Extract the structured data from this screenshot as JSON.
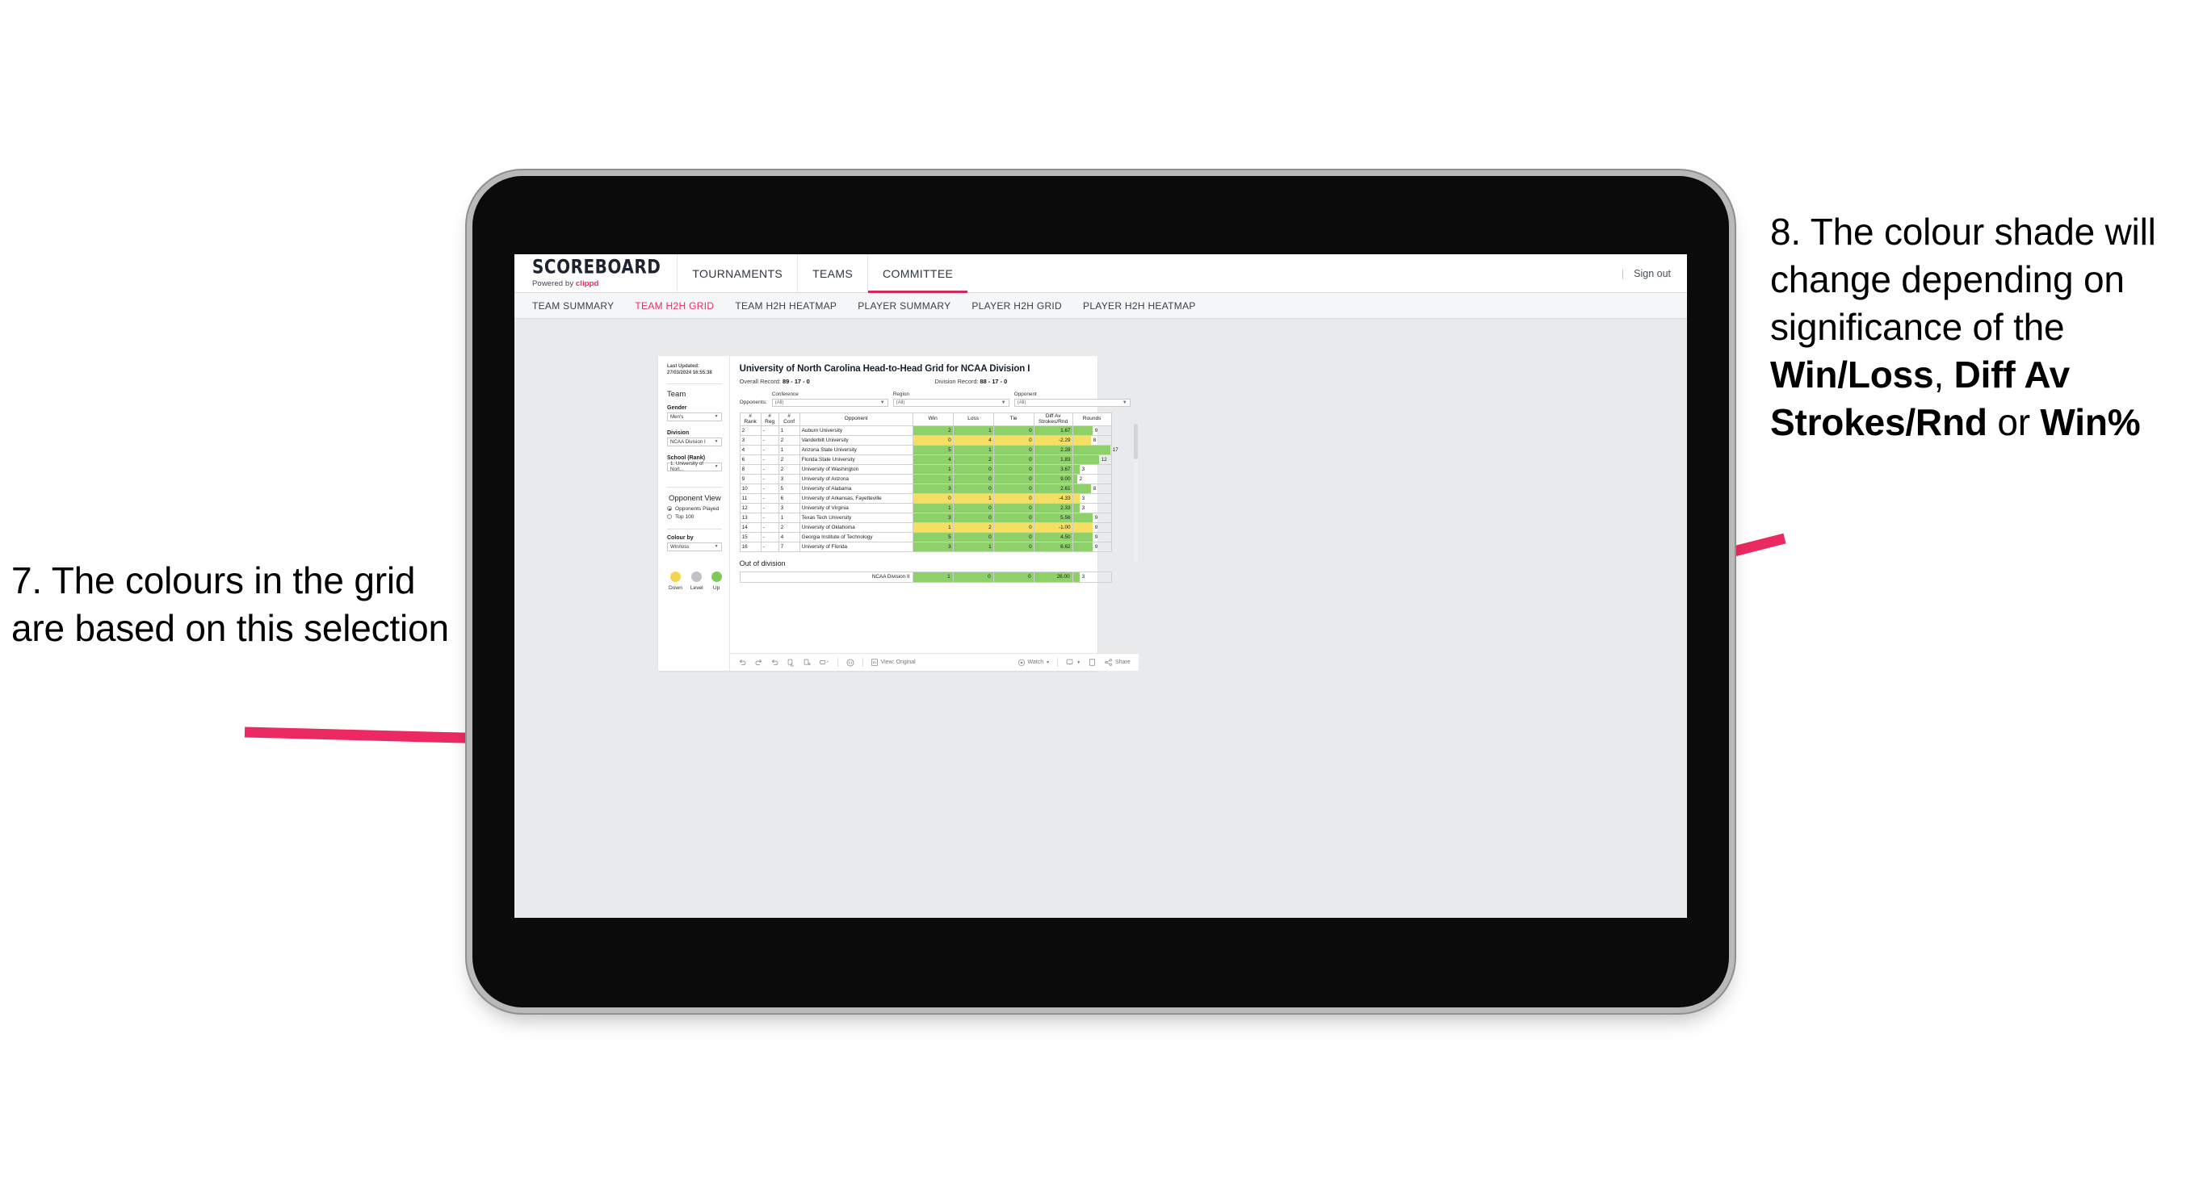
{
  "annotations": {
    "left": {
      "number": "7.",
      "text": "7. The colours in the grid are based on this selection"
    },
    "right": {
      "part1": "8. The colour shade will change depending on significance of the ",
      "bold1": "Win/Loss",
      "mid1": ", ",
      "bold2": "Diff Av Strokes/Rnd",
      "mid2": " or ",
      "bold3": "Win%"
    },
    "arrow_color": "#ec2a62"
  },
  "topnav": {
    "logo": "SCOREBOARD",
    "tagline_prefix": "Powered by ",
    "tagline_brand": "clippd",
    "items": [
      {
        "label": "TOURNAMENTS",
        "active": false
      },
      {
        "label": "TEAMS",
        "active": false
      },
      {
        "label": "COMMITTEE",
        "active": true
      }
    ],
    "signout": "Sign out",
    "separator": "|",
    "accent": "#d0295a"
  },
  "subnav": {
    "items": [
      {
        "label": "TEAM SUMMARY",
        "active": false
      },
      {
        "label": "TEAM H2H GRID",
        "active": true
      },
      {
        "label": "TEAM H2H HEATMAP",
        "active": false
      },
      {
        "label": "PLAYER SUMMARY",
        "active": false
      },
      {
        "label": "PLAYER H2H GRID",
        "active": false
      },
      {
        "label": "PLAYER H2H HEATMAP",
        "active": false
      }
    ]
  },
  "filters": {
    "last_updated": "Last Updated: 27/03/2024 16:55:38",
    "team_heading": "Team",
    "gender_label": "Gender",
    "gender_value": "Men's",
    "division_label": "Division",
    "division_value": "NCAA Division I",
    "school_label": "School (Rank)",
    "school_value": "1. University of Nort...",
    "opponent_view_heading": "Opponent View",
    "opponent_view_options": [
      {
        "label": "Opponents Played",
        "selected": true
      },
      {
        "label": "Top 100",
        "selected": false
      }
    ],
    "colour_by_label": "Colour by",
    "colour_by_value": "Win/loss",
    "legend": [
      {
        "label": "Down",
        "color": "#f4d252"
      },
      {
        "label": "Level",
        "color": "#bfc2c7"
      },
      {
        "label": "Up",
        "color": "#7ec95a"
      }
    ]
  },
  "viz": {
    "title": "University of North Carolina Head-to-Head Grid for NCAA Division I",
    "overall_record_label": "Overall Record: ",
    "overall_record_value": "89 - 17 - 0",
    "division_record_label": "Division Record: ",
    "division_record_value": "88 - 17 - 0",
    "opponents_label": "Opponents:",
    "opponent_filters": [
      {
        "caption": "Conference",
        "value": "(All)"
      },
      {
        "caption": "Region",
        "value": "(All)"
      },
      {
        "caption": "Opponent",
        "value": "(All)"
      }
    ],
    "out_of_division_title": "Out of division"
  },
  "chart_data": {
    "type": "table",
    "title": "University of North Carolina Head-to-Head Grid for NCAA Division I",
    "columns": [
      "# Rank",
      "# Reg",
      "# Conf",
      "Opponent",
      "Win",
      "Loss",
      "Tie",
      "Diff Av Strokes/Rnd",
      "Rounds"
    ],
    "column_headers_multiline": [
      [
        "#",
        "Rank"
      ],
      [
        "#",
        "Reg"
      ],
      [
        "#",
        "Conf"
      ],
      [
        "Opponent"
      ],
      [
        "Win"
      ],
      [
        "Loss"
      ],
      [
        "Tie"
      ],
      [
        "Diff Av",
        "Strokes/Rnd"
      ],
      [
        "Rounds"
      ]
    ],
    "colour_by": "Win/loss",
    "colours": {
      "up": "#8ed16a",
      "down": "#f6dd63",
      "level": "#bfc2c7"
    },
    "rounds_max": 17,
    "rows": [
      {
        "rank": "2",
        "reg": "-",
        "conf": "1",
        "opponent": "Auburn University",
        "win": "2",
        "loss": "1",
        "tie": "0",
        "diff": "1.67",
        "rounds": 9,
        "state": "up"
      },
      {
        "rank": "3",
        "reg": "-",
        "conf": "2",
        "opponent": "Vanderbilt University",
        "win": "0",
        "loss": "4",
        "tie": "0",
        "diff": "-2.29",
        "rounds": 8,
        "state": "down"
      },
      {
        "rank": "4",
        "reg": "-",
        "conf": "1",
        "opponent": "Arizona State University",
        "win": "5",
        "loss": "1",
        "tie": "0",
        "diff": "2.28",
        "rounds": 17,
        "state": "up"
      },
      {
        "rank": "6",
        "reg": "-",
        "conf": "2",
        "opponent": "Florida State University",
        "win": "4",
        "loss": "2",
        "tie": "0",
        "diff": "1.83",
        "rounds": 12,
        "state": "up"
      },
      {
        "rank": "8",
        "reg": "-",
        "conf": "2",
        "opponent": "University of Washington",
        "win": "1",
        "loss": "0",
        "tie": "0",
        "diff": "3.67",
        "rounds": 3,
        "state": "up"
      },
      {
        "rank": "9",
        "reg": "-",
        "conf": "3",
        "opponent": "University of Arizona",
        "win": "1",
        "loss": "0",
        "tie": "0",
        "diff": "9.00",
        "rounds": 2,
        "state": "up"
      },
      {
        "rank": "10",
        "reg": "-",
        "conf": "5",
        "opponent": "University of Alabama",
        "win": "3",
        "loss": "0",
        "tie": "0",
        "diff": "2.61",
        "rounds": 8,
        "state": "up"
      },
      {
        "rank": "11",
        "reg": "-",
        "conf": "6",
        "opponent": "University of Arkansas, Fayetteville",
        "win": "0",
        "loss": "1",
        "tie": "0",
        "diff": "-4.33",
        "rounds": 3,
        "state": "down"
      },
      {
        "rank": "12",
        "reg": "-",
        "conf": "3",
        "opponent": "University of Virginia",
        "win": "1",
        "loss": "0",
        "tie": "0",
        "diff": "2.33",
        "rounds": 3,
        "state": "up"
      },
      {
        "rank": "13",
        "reg": "-",
        "conf": "1",
        "opponent": "Texas Tech University",
        "win": "3",
        "loss": "0",
        "tie": "0",
        "diff": "5.56",
        "rounds": 9,
        "state": "up"
      },
      {
        "rank": "14",
        "reg": "-",
        "conf": "2",
        "opponent": "University of Oklahoma",
        "win": "1",
        "loss": "2",
        "tie": "0",
        "diff": "-1.00",
        "rounds": 9,
        "state": "down"
      },
      {
        "rank": "15",
        "reg": "-",
        "conf": "4",
        "opponent": "Georgia Institute of Technology",
        "win": "5",
        "loss": "0",
        "tie": "0",
        "diff": "4.50",
        "rounds": 9,
        "state": "up"
      },
      {
        "rank": "16",
        "reg": "-",
        "conf": "7",
        "opponent": "University of Florida",
        "win": "3",
        "loss": "1",
        "tie": "0",
        "diff": "6.62",
        "rounds": 9,
        "state": "up"
      }
    ],
    "out_of_division_rows": [
      {
        "name": "NCAA Division II",
        "win": "1",
        "loss": "0",
        "tie": "0",
        "diff": "26.00",
        "rounds": 3,
        "state": "up"
      }
    ]
  },
  "vizbar": {
    "view_label": "View: Original",
    "watch_label": "Watch",
    "share_label": "Share"
  }
}
